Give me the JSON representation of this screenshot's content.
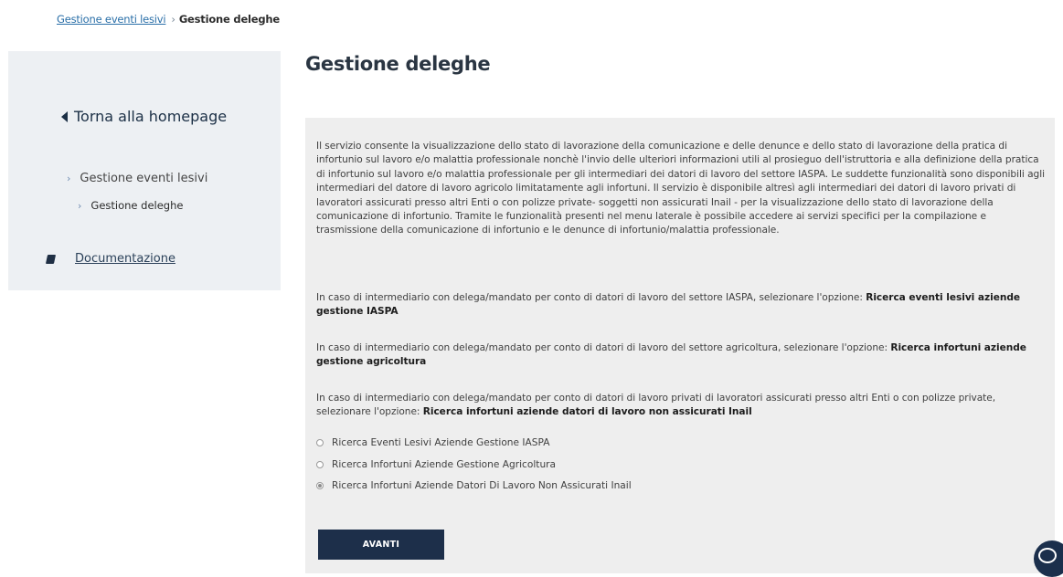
{
  "breadcrumb": {
    "parent": "Gestione eventi lesivi",
    "separator": "›",
    "current": "Gestione deleghe"
  },
  "sidebar": {
    "back_label": "Torna alla homepage",
    "items": [
      {
        "label": "Gestione eventi lesivi"
      },
      {
        "label": "Gestione deleghe"
      }
    ],
    "doc_label": "Documentazione",
    "chevron": "›"
  },
  "main": {
    "title": "Gestione deleghe",
    "intro": "Il servizio consente la visualizzazione dello stato di lavorazione della comunicazione e delle denunce e dello stato di lavorazione della pratica di infortunio sul lavoro e/o malattia professionale nonchè l'invio delle ulteriori informazioni utili al prosieguo dell'istruttoria e alla definizione della pratica di infortunio sul lavoro e/o malattia professionale per gli intermediari dei datori di lavoro del settore IASPA. Le suddette funzionalità sono disponibili agli intermediari del datore di lavoro agricolo limitatamente agli infortuni. Il servizio è disponibile altresì agli intermediari dei datori di lavoro privati di lavoratori assicurati presso altri Enti o con polizze private- soggetti non assicurati Inail - per la visualizzazione dello stato di lavorazione della comunicazione di infortunio. Tramite le funzionalità presenti nel menu laterale è possibile accedere ai servizi specifici per la compilazione e trasmissione della comunicazione di infortunio e le denunce di infortunio/malattia professionale.",
    "option_texts": [
      {
        "prefix": "In caso di intermediario con delega/mandato per conto di datori di lavoro del settore IASPA, selezionare l'opzione: ",
        "bold": "Ricerca eventi lesivi aziende gestione IASPA"
      },
      {
        "prefix": "In caso di intermediario con delega/mandato per conto di datori di lavoro del settore agricoltura, selezionare l'opzione: ",
        "bold": "Ricerca infortuni aziende gestione agricoltura"
      },
      {
        "prefix": "In caso di intermediario con delega/mandato per conto di datori di lavoro privati di lavoratori assicurati presso altri Enti o con polizze private, selezionare l'opzione: ",
        "bold": "Ricerca infortuni aziende datori di lavoro non assicurati Inail"
      }
    ],
    "radios": [
      {
        "label": "Ricerca Eventi Lesivi Aziende Gestione IASPA",
        "checked": false
      },
      {
        "label": "Ricerca Infortuni Aziende Gestione Agricoltura",
        "checked": false
      },
      {
        "label": "Ricerca Infortuni Aziende Datori Di Lavoro Non Assicurati Inail",
        "checked": true
      }
    ],
    "button_label": "AVANTI"
  },
  "icons": {
    "back": "triangle-left-icon",
    "doc": "book-icon",
    "chat": "chat-icon"
  },
  "colors": {
    "primary": "#1d2f4a",
    "link": "#2a6fa8",
    "sidebar_bg": "#edf0f3",
    "panel_bg": "#eeeeee"
  }
}
